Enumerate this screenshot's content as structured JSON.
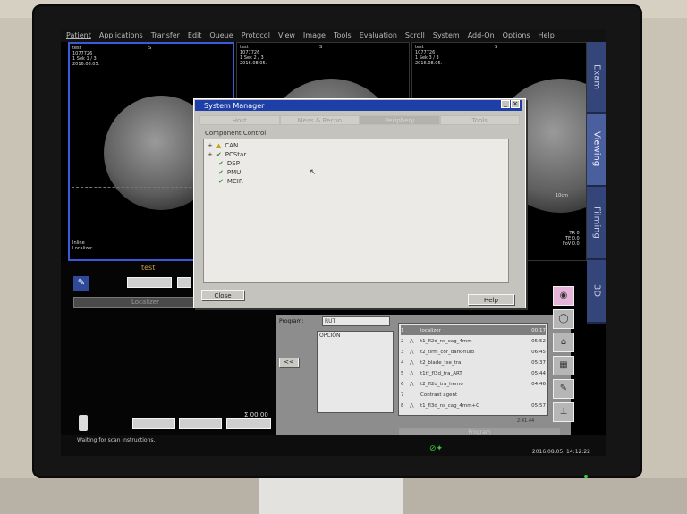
{
  "menu": [
    "Patient",
    "Applications",
    "Transfer",
    "Edit",
    "Queue",
    "Protocol",
    "View",
    "Image",
    "Tools",
    "Evaluation",
    "Scroll",
    "System",
    "Add-On",
    "Options",
    "Help"
  ],
  "viewports": [
    {
      "title": "test",
      "id": "1077726",
      "slice": "1 Sek 1 / 3",
      "date": "2016.08.05.",
      "orient": "S"
    },
    {
      "title": "test",
      "id": "1077726",
      "slice": "1 Sek 2 / 3",
      "date": "2016.08.05.",
      "orient": "S"
    },
    {
      "title": "test",
      "id": "1077726",
      "slice": "1 Sek 3 / 3",
      "date": "2016.08.05.",
      "orient": "S"
    }
  ],
  "viewport_right_info": {
    "scale": "10cm",
    "tr": "TR 0",
    "te": "TE 0.0",
    "fov": "FoV 0.0"
  },
  "viewport_left_info": {
    "line1": "Inline",
    "line2": "Localizer"
  },
  "exam_tabs": [
    {
      "label": "Exam",
      "active": false
    },
    {
      "label": "Viewing",
      "active": true
    },
    {
      "label": "Filming",
      "active": false
    },
    {
      "label": "3D",
      "active": false
    }
  ],
  "system_manager": {
    "title": "System Manager",
    "tabs": [
      "Host",
      "Meas & Recon",
      "Periphery",
      "Tools"
    ],
    "selected_tab": "Periphery",
    "group_label": "Component Control",
    "components": [
      {
        "name": "CAN",
        "status": "warning",
        "expand": "+"
      },
      {
        "name": "PCStar",
        "status": "ok",
        "expand": "+"
      },
      {
        "name": "DSP",
        "status": "ok",
        "expand": ""
      },
      {
        "name": "PMU",
        "status": "ok",
        "expand": ""
      },
      {
        "name": "MCIR",
        "status": "ok",
        "expand": ""
      }
    ],
    "close_label": "Close",
    "help_label": "Help"
  },
  "patient_name_label": "test",
  "localizer_label": "Localizer",
  "program": {
    "program_label": "Program:",
    "program_value": "RUT",
    "option_label": "OPCIÓN",
    "arrow_button": "<<",
    "footer_label": "Program",
    "time_total": "2:41.44",
    "protocols": [
      {
        "num": "1",
        "name": "localizer",
        "time": "00:17",
        "selected": true
      },
      {
        "num": "2",
        "name": "t1_fl2d_ns_cag_4mm",
        "time": "05:52",
        "selected": false
      },
      {
        "num": "3",
        "name": "t2_tirm_cor_dark-fluid",
        "time": "06:45",
        "selected": false
      },
      {
        "num": "4",
        "name": "t2_blade_tse_tra",
        "time": "05:37",
        "selected": false
      },
      {
        "num": "5",
        "name": "t1tf_fl3d_tra_ART",
        "time": "05:44",
        "selected": false
      },
      {
        "num": "6",
        "name": "t2_fl2d_tra_hemo",
        "time": "04:46",
        "selected": false
      },
      {
        "num": "7",
        "name": "Contrast agent",
        "time": "",
        "selected": false
      },
      {
        "num": "8",
        "name": "t1_fl3d_ns_cag_4mm+C",
        "time": "05:57",
        "selected": false
      }
    ]
  },
  "timer": "Σ 00:00",
  "status_text": "Waiting for scan instructions.",
  "datetime": "2016.08.05.   14:12:22"
}
